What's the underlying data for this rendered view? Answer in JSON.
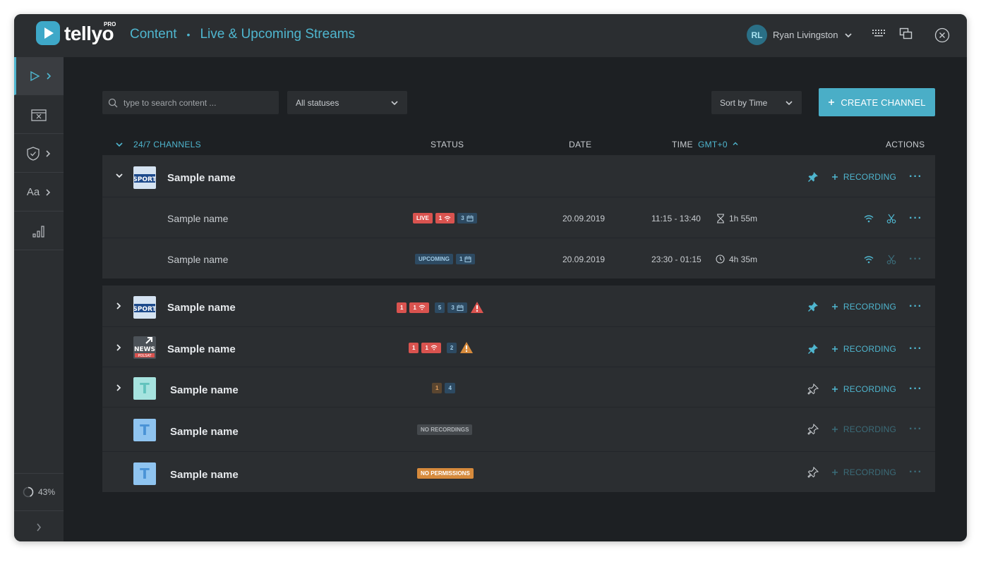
{
  "app": {
    "logo_text": "tellyo",
    "logo_badge": "PRO",
    "breadcrumb": [
      "Content",
      "Live & Upcoming Streams"
    ],
    "breadcrumb_sep": "•"
  },
  "user": {
    "initials": "RL",
    "name": "Ryan Livingston"
  },
  "sidebar": {
    "text_item": "Aa",
    "progress": "43%"
  },
  "search": {
    "placeholder": "type to search content ..."
  },
  "filters": {
    "status": "All statuses",
    "sort": "Sort by Time"
  },
  "create_label": "CREATE CHANNEL",
  "table": {
    "section": "24/7 CHANNELS",
    "col_status": "STATUS",
    "col_date": "DATE",
    "col_time": "TIME",
    "timezone": "GMT+0",
    "col_actions": "ACTIONS"
  },
  "recording_label": "RECORDING",
  "channels": [
    {
      "name": "Sample name",
      "logo": "SPORT",
      "expanded": true,
      "pinned": true,
      "badges": [],
      "children": [
        {
          "name": "Sample name",
          "badges": [
            {
              "type": "live",
              "text": "LIVE"
            },
            {
              "type": "wifi",
              "text": "1"
            },
            {
              "type": "cal",
              "text": "3"
            }
          ],
          "date": "20.09.2019",
          "time": "11:15 - 13:40",
          "duration": "1h 55m",
          "duration_icon": "hourglass-icon"
        },
        {
          "name": "Sample name",
          "badges": [
            {
              "type": "upcoming",
              "text": "UPCOMING"
            },
            {
              "type": "cal",
              "text": "1"
            }
          ],
          "date": "20.09.2019",
          "time": "23:30 - 01:15",
          "duration": "4h 35m",
          "duration_icon": "clock-icon"
        }
      ]
    },
    {
      "name": "Sample name",
      "logo": "SPORT",
      "pinned": true,
      "badges": [
        {
          "type": "red",
          "text": "1"
        },
        {
          "type": "wifi",
          "text": "1"
        },
        {
          "type": "blue",
          "text": "5"
        },
        {
          "type": "cal",
          "text": "3"
        }
      ],
      "warning": "red"
    },
    {
      "name": "Sample name",
      "logo": "NEWS",
      "logo_sub": "POLSAT",
      "pinned": true,
      "badges": [
        {
          "type": "red",
          "text": "1"
        },
        {
          "type": "wifi",
          "text": "1"
        },
        {
          "type": "blue",
          "text": "2"
        }
      ],
      "warning": "orange"
    },
    {
      "name": "Sample name",
      "logo": "T",
      "pinned": false,
      "badges": [
        {
          "type": "brown",
          "text": "1"
        },
        {
          "type": "blue",
          "text": "4"
        }
      ]
    },
    {
      "name": "Sample name",
      "logo": "T",
      "pinned": false,
      "disabled": true,
      "badges": [
        {
          "type": "gray",
          "text": "NO RECORDINGS"
        }
      ]
    },
    {
      "name": "Sample name",
      "logo": "T",
      "pinned": false,
      "disabled": true,
      "badges": [
        {
          "type": "orange",
          "text": "NO PERMISSIONS"
        }
      ]
    }
  ],
  "colors": {
    "accent": "#4fb6cf",
    "background": "#1d2023",
    "panel": "#2b2e31",
    "live": "#d9534f",
    "warning": "#d68a3c"
  }
}
